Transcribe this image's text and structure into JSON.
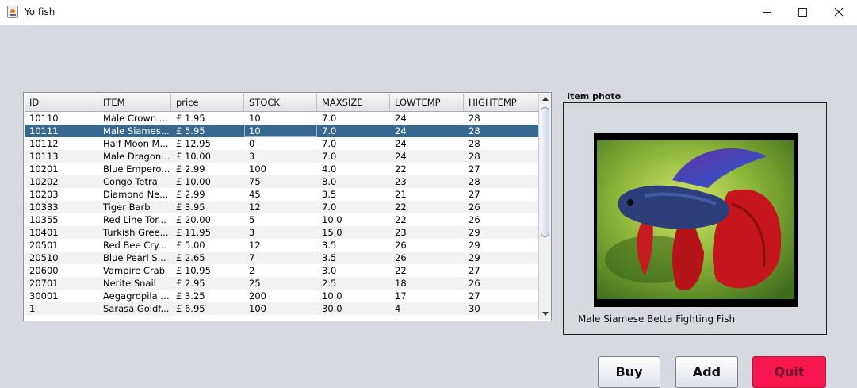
{
  "window": {
    "title": "Yo fish",
    "icon": "java-cup-icon",
    "controls": [
      "minimize-icon",
      "maximize-icon",
      "close-icon"
    ]
  },
  "table": {
    "columns": [
      "ID",
      "ITEM",
      "price",
      "STOCK",
      "MAXSIZE",
      "LOWTEMP",
      "HIGHTEMP"
    ],
    "selected_row": 1,
    "rows": [
      [
        "10110",
        "Male Crown ...",
        "£ 1.95",
        "10",
        "7.0",
        "24",
        "28"
      ],
      [
        "10111",
        "Male Siames...",
        "£ 5.95",
        "10",
        "7.0",
        "24",
        "28"
      ],
      [
        "10112",
        "Half Moon M...",
        "£ 12.95",
        "0",
        "7.0",
        "24",
        "28"
      ],
      [
        "10113",
        "Male Dragon ...",
        "£ 10.00",
        "3",
        "7.0",
        "24",
        "28"
      ],
      [
        "10201",
        "Blue Empero...",
        "£ 2.99",
        "100",
        "4.0",
        "22",
        "27"
      ],
      [
        "10202",
        "Congo Tetra",
        "£ 10.00",
        "75",
        "8.0",
        "23",
        "28"
      ],
      [
        "10203",
        "Diamond Ne...",
        "£ 2.99",
        "45",
        "3.5",
        "21",
        "27"
      ],
      [
        "10333",
        "Tiger Barb",
        "£ 3.95",
        "12",
        "7.0",
        "22",
        "26"
      ],
      [
        "10355",
        "Red Line Tor...",
        "£ 20.00",
        "5",
        "10.0",
        "22",
        "26"
      ],
      [
        "10401",
        "Turkish Gree...",
        "£ 11.95",
        "3",
        "15.0",
        "23",
        "29"
      ],
      [
        "20501",
        "Red Bee Cry...",
        "£ 5.00",
        "12",
        "3.5",
        "26",
        "29"
      ],
      [
        "20510",
        "Blue Pearl S...",
        "£ 2.65",
        "7",
        "3.5",
        "26",
        "29"
      ],
      [
        "20600",
        "Vampire Crab",
        "£ 10.95",
        "2",
        "3.0",
        "22",
        "27"
      ],
      [
        "20701",
        "Nerite Snail",
        "£ 2.95",
        "25",
        "2.5",
        "18",
        "26"
      ],
      [
        "30001",
        "Aegagropila l...",
        "£ 3.25",
        "200",
        "10.0",
        "17",
        "27"
      ],
      [
        "1",
        "Sarasa Goldf...",
        "£ 6.95",
        "100",
        "30.0",
        "4",
        "30"
      ]
    ]
  },
  "photo": {
    "label": "Item photo",
    "caption": "Male Siamese Betta Fighting Fish",
    "image": "betta-fish-photo"
  },
  "buttons": {
    "buy": "Buy",
    "add": "Add",
    "quit": "Quit"
  },
  "colors": {
    "background": "#d6d9e0",
    "selection": "#39688e",
    "quit": "#f8164f"
  }
}
